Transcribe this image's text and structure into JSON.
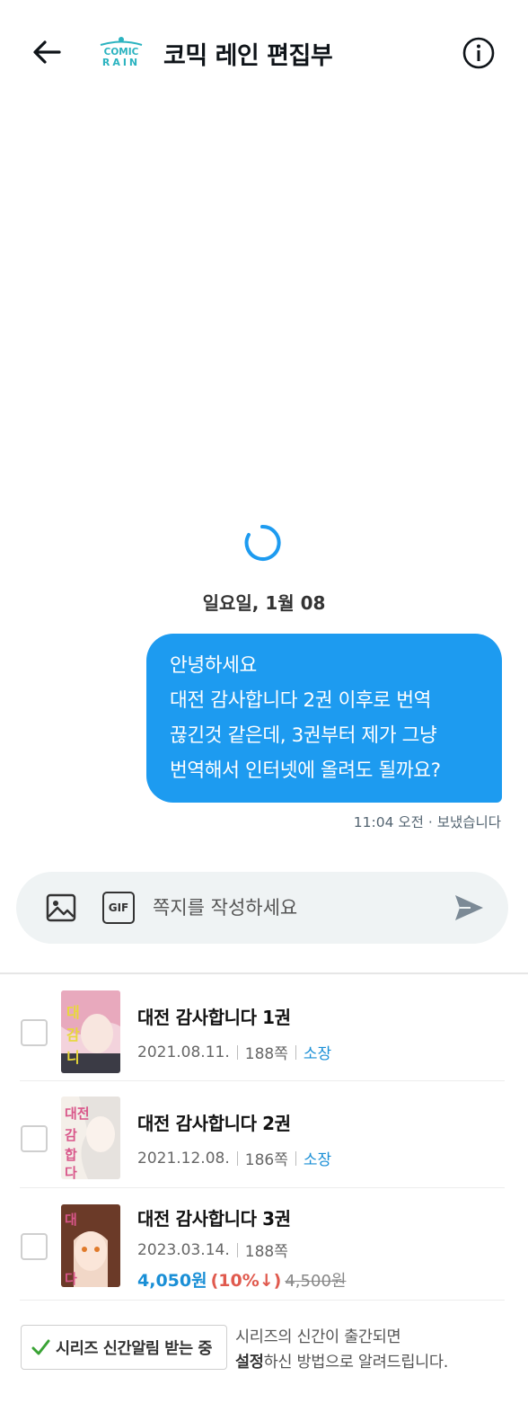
{
  "header": {
    "title": "코믹 레인 편집부",
    "logo_text_top": "COMIC",
    "logo_text_bottom": "RAIN",
    "back_icon": "arrow-left-icon",
    "info_icon": "info-icon"
  },
  "conversation": {
    "date_label": "일요일, 1월 08",
    "message": {
      "lines": [
        "안녕하세요",
        "대전 감사합니다 2권 이후로 번역",
        "끊긴것 같은데, 3권부터 제가 그냥",
        "번역해서 인터넷에 올려도 될까요?"
      ],
      "meta": "11:04 오전 · 보냈습니다"
    }
  },
  "composer": {
    "placeholder": "쪽지를 작성하세요",
    "gif_label": "GIF",
    "image_icon": "image-icon",
    "send_icon": "send-icon"
  },
  "books": [
    {
      "title": "대전 감사합니다 1권",
      "date": "2021.08.11.",
      "pages": "188쪽",
      "status": "소장"
    },
    {
      "title": "대전 감사합니다 2권",
      "date": "2021.12.08.",
      "pages": "186쪽",
      "status": "소장"
    },
    {
      "title": "대전 감사합니다 3권",
      "date": "2023.03.14.",
      "pages": "188쪽",
      "price": "4,050원",
      "discount": "(10%↓)",
      "original_price": "4,500원"
    }
  ],
  "footer": {
    "alarm_label": "시리즈 신간알림 받는 중",
    "note_line1": "시리즈의 신간이 출간되면",
    "note_bold": "설정",
    "note_line2_rest": "하신 방법으로 알려드립니다."
  },
  "colors": {
    "accent": "#1d9bf0",
    "link": "#1a8fd6",
    "discount": "#e05a4e",
    "check": "#3aa335"
  }
}
